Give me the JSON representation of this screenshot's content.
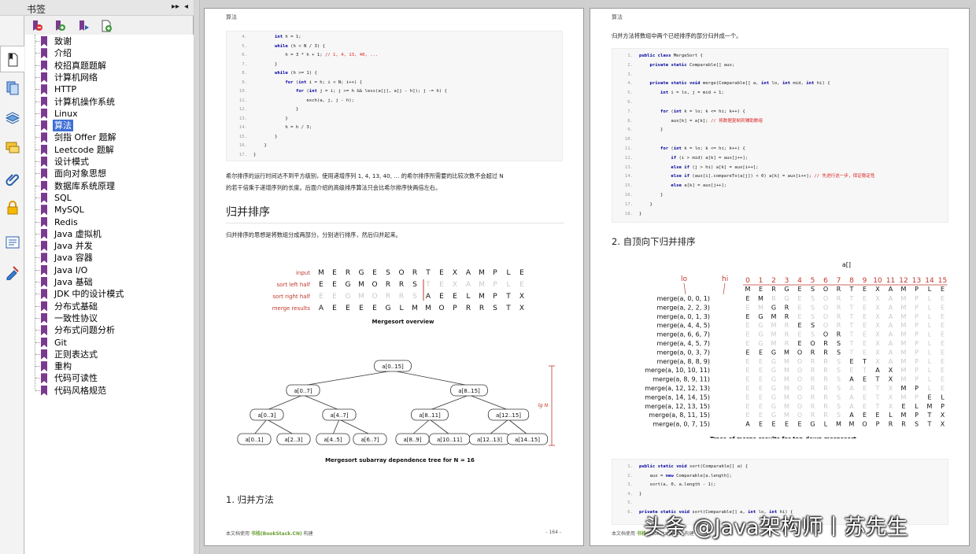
{
  "sidebar": {
    "title": "书签",
    "expand_button": "▸▸",
    "collapse_button": "◂",
    "bookmarks": [
      "致谢",
      "介绍",
      "校招真题题解",
      "计算机网络",
      "HTTP",
      "计算机操作系统",
      "Linux",
      "算法",
      "剑指 Offer 题解",
      "Leetcode 题解",
      "设计模式",
      "面向对象思想",
      "数据库系统原理",
      "SQL",
      "MySQL",
      "Redis",
      "Java 虚拟机",
      "Java 并发",
      "Java 容器",
      "Java I/O",
      "Java 基础",
      "JDK 中的设计模式",
      "分布式基础",
      "一致性协议",
      "分布式问题分析",
      "Git",
      "正则表达式",
      "重构",
      "代码可读性",
      "代码风格规范"
    ],
    "selected_index": 7,
    "rail_icons": [
      "bookmarks-icon",
      "pages-icon",
      "layers-icon",
      "comments-icon",
      "attachments-icon",
      "lock-icon",
      "fields-icon",
      "signatures-icon"
    ],
    "toolbar_icons": [
      "delete-bookmark-icon",
      "add-bookmark-icon",
      "expand-bookmark-icon",
      "bookmark-properties-icon"
    ]
  },
  "page1": {
    "header": "算法",
    "code_lines": [
      {
        "n": "4.",
        "t": "        int h = 1;"
      },
      {
        "n": "5.",
        "t": "        while (h < N / 3) {"
      },
      {
        "n": "6.",
        "t": "            h = 3 * h + 1; // 1, 4, 13, 40, ..."
      },
      {
        "n": "7.",
        "t": "        }"
      },
      {
        "n": "8.",
        "t": "        while (h >= 1) {"
      },
      {
        "n": "9.",
        "t": "            for (int i = h; i < N; i++) {"
      },
      {
        "n": "10.",
        "t": "                for (int j = i; j >= h && less(a[j], a[j - h]); j -= h) {"
      },
      {
        "n": "11.",
        "t": "                    exch(a, j, j - h);"
      },
      {
        "n": "12.",
        "t": "                }"
      },
      {
        "n": "13.",
        "t": "            }"
      },
      {
        "n": "14.",
        "t": "            h = h / 3;"
      },
      {
        "n": "15.",
        "t": "        }"
      },
      {
        "n": "16.",
        "t": "    }"
      },
      {
        "n": "17.",
        "t": "}"
      }
    ],
    "para1_line1": "希尔排序的运行时间达不到平方级别，使用递增序列 1, 4, 13, 40, … 的希尔排序所需要的比较次数不会超过 N",
    "para1_line2": "的若干倍乘于递增序列的长度。后面介绍的高级排序算法只会比希尔排序快两倍左右。",
    "heading": "归并排序",
    "para2": "归并排序的思想是将数组分成两部分，分别进行排序，然后归并起来。",
    "overview": {
      "labels": [
        "input",
        "sort left half",
        "sort right half",
        "merge results"
      ],
      "rows": [
        "M E R G E S O R T E X A M P L E",
        "E E G M O R R S T E X A M P L E",
        "E E G M O R R S A E E L M P T X",
        "A E E E E G L M M O P R R S T X"
      ],
      "caption": "Mergesort overview"
    },
    "tree": {
      "nodes": [
        "a[0..15]",
        "a[0..7]",
        "a[8..15]",
        "a[0..3]",
        "a[4..7]",
        "a[8..11]",
        "a[12..15]",
        "a[0..1]",
        "a[2..3]",
        "a[4..5]",
        "a[6..7]",
        "a[8..9]",
        "a[10..11]",
        "a[12..13]",
        "a[14..15]"
      ],
      "side_label": "lg N",
      "caption": "Mergesort subarray dependence tree for N = 16"
    },
    "subheading": "1. 归并方法",
    "footer_prefix": "本文档使用 ",
    "footer_link": "书栈(BookStack.CN)",
    "footer_suffix": " 构建",
    "page_number": "- 164 -"
  },
  "page2": {
    "header": "算法",
    "intro": "归并方法将数组中两个已经排序的部分归并成一个。",
    "code_lines": [
      {
        "n": "1.",
        "t": "public class MergeSort {"
      },
      {
        "n": "2.",
        "t": "    private static Comparable[] aux;"
      },
      {
        "n": "3.",
        "t": ""
      },
      {
        "n": "4.",
        "t": "    private static void merge(Comparable[] a, int lo, int mid, int hi) {"
      },
      {
        "n": "5.",
        "t": "        int i = lo, j = mid + 1;"
      },
      {
        "n": "6.",
        "t": ""
      },
      {
        "n": "7.",
        "t": "        for (int k = lo; k <= hi; k++) {"
      },
      {
        "n": "8.",
        "t": "            aux[k] = a[k]; // 将数据复制到辅助数组"
      },
      {
        "n": "9.",
        "t": "        }"
      },
      {
        "n": "10.",
        "t": ""
      },
      {
        "n": "11.",
        "t": "        for (int k = lo; k <= hi; k++) {"
      },
      {
        "n": "12.",
        "t": "            if (i > mid) a[k] = aux[j++];"
      },
      {
        "n": "13.",
        "t": "            else if (j > hi) a[k] = aux[i++];"
      },
      {
        "n": "14.",
        "t": "            else if (aux[i].compareTo(a[j]) < 0) a[k] = aux[i++]; // 先进行这一步，保证稳定性"
      },
      {
        "n": "15.",
        "t": "            else a[k] = aux[j++];"
      },
      {
        "n": "16.",
        "t": "        }"
      },
      {
        "n": "17.",
        "t": "    }"
      },
      {
        "n": "18.",
        "t": "}"
      }
    ],
    "heading": "2. 自顶向下归并排序",
    "trace": {
      "array_label": "a[]",
      "lo_label": "lo",
      "hi_label": "hi",
      "indices": [
        "0",
        "1",
        "2",
        "3",
        "4",
        "5",
        "6",
        "7",
        "8",
        "9",
        "10",
        "11",
        "12",
        "13",
        "14",
        "15"
      ],
      "header_row": "M E R G E S O R T E X A M P L E",
      "calls": [
        "merge(a,  0,  0,  1)",
        "merge(a,  2,  2,  3)",
        "merge(a,  0,  1,  3)",
        "merge(a,  4,  4,  5)",
        "merge(a,  6,  6,  7)",
        "merge(a,  4,  5,  7)",
        "merge(a,  0,  3,  7)",
        "merge(a,  8,  8,  9)",
        "merge(a, 10, 10, 11)",
        "merge(a,  8,  9, 11)",
        "merge(a, 12, 12, 13)",
        "merge(a, 14, 14, 15)",
        "merge(a, 12, 13, 15)",
        "merge(a,  8, 11, 15)",
        "merge(a,  0,  7, 15)"
      ],
      "rows": [
        "E M R G E S O R T E X A M P L E",
        "E M G R E S O R T E X A M P L E",
        "E G M R E S O R T E X A M P L E",
        "E G M R E S O R T E X A M P L E",
        "E G M R E S O R T E X A M P L E",
        "E G M R E O R S T E X A M P L E",
        "E E G M O R R S T E X A M P L E",
        "E E G M O R R S E T X A M P L E",
        "E E G M O R R S E T A X M P L E",
        "E E G M O R R S A E T X M P L E",
        "E E G M O R R S A E T X M P L E",
        "E E G M O R R S A E T X M P E L",
        "E E G M O R R S A E T X E L M P",
        "E E G M O R R S A E E L M P T X",
        "A E E E E G L M M O P R R S T X"
      ],
      "caption": "Trace of merge results for top-down mergesort"
    },
    "code2_lines": [
      {
        "n": "1.",
        "t": "public static void sort(Comparable[] a) {"
      },
      {
        "n": "2.",
        "t": "    aux = new Comparable[a.length];"
      },
      {
        "n": "3.",
        "t": "    sort(a, 0, a.length - 1);"
      },
      {
        "n": "4.",
        "t": "}"
      },
      {
        "n": "5.",
        "t": ""
      },
      {
        "n": "6.",
        "t": "private static void sort(Comparable[] a, int lo, int hi) {"
      }
    ],
    "footer_prefix": "本文档使用 ",
    "footer_link": "书栈",
    "footer_suffix": "(BookStack.CN) 构建"
  },
  "watermark": "头条 @Java架构师丨苏先生"
}
